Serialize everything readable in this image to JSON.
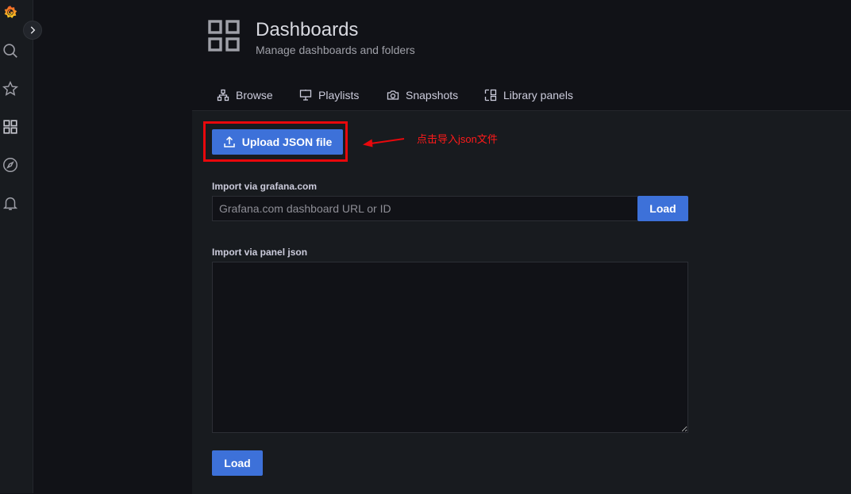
{
  "header": {
    "title": "Dashboards",
    "subtitle": "Manage dashboards and folders"
  },
  "tabs": [
    {
      "label": "Browse",
      "icon": "sitemap-icon"
    },
    {
      "label": "Playlists",
      "icon": "presentation-icon"
    },
    {
      "label": "Snapshots",
      "icon": "camera-icon"
    },
    {
      "label": "Library panels",
      "icon": "library-panel-icon"
    }
  ],
  "sidebar": {
    "icons": [
      "grafana-logo",
      "search-icon",
      "star-icon",
      "apps-icon",
      "compass-icon",
      "bell-icon"
    ]
  },
  "upload": {
    "label": "Upload JSON file"
  },
  "annotation": {
    "text": "点击导入json文件",
    "color": "#ff1a1a"
  },
  "grafana_import": {
    "label": "Import via grafana.com",
    "placeholder": "Grafana.com dashboard URL or ID",
    "button": "Load"
  },
  "panel_import": {
    "label": "Import via panel json",
    "button": "Load"
  },
  "colors": {
    "primary": "#3d71d9",
    "highlight": "#e8080c",
    "background": "#111217",
    "panel": "#181b1f"
  }
}
